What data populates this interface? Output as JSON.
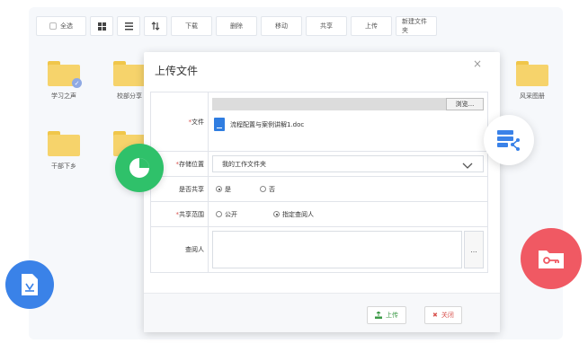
{
  "toolbar": {
    "select_all": "全选",
    "download": "下载",
    "delete": "删除",
    "move": "移动",
    "share": "共享",
    "upload": "上传",
    "new_folder": "新建文件夹"
  },
  "folders": [
    {
      "label": "学习之声"
    },
    {
      "label": "校部分享"
    },
    {
      "label": "风采图册"
    },
    {
      "label": "干部下乡"
    }
  ],
  "dialog": {
    "title": "上传文件",
    "close": "×",
    "fields": {
      "file": {
        "label": "文件",
        "browse": "浏览...",
        "filename": "流程配置与案例讲解1.doc"
      },
      "location": {
        "label": "存储位置",
        "value": "我的工作文件夹"
      },
      "shared": {
        "label": "是否共享",
        "yes": "是",
        "no": "否",
        "selected": "yes"
      },
      "scope": {
        "label": "共享范围",
        "public": "公开",
        "specified": "指定查阅人",
        "selected": "specified"
      },
      "viewer": {
        "label": "查阅人",
        "more": "..."
      }
    },
    "upload_button": "上传",
    "close_button": "关闭"
  },
  "colors": {
    "green": "#2fc16a",
    "blue": "#3a82e8",
    "red": "#f05963",
    "folder": "#f6d36b"
  }
}
